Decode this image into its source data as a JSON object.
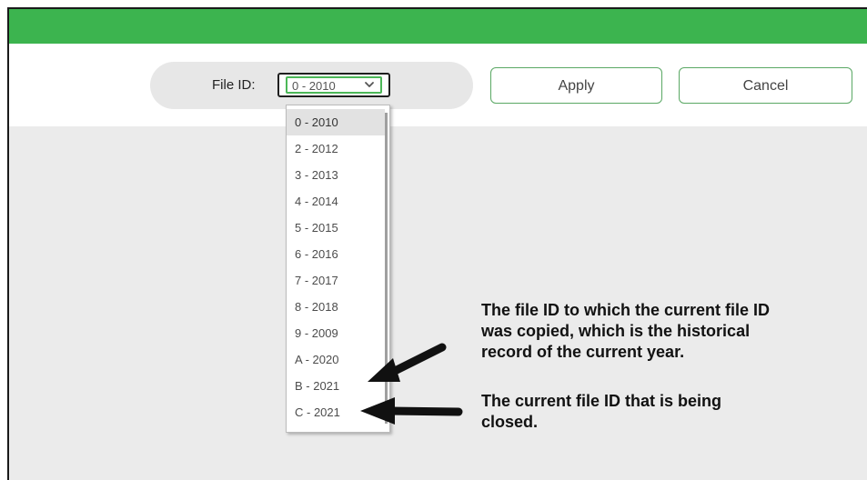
{
  "file_id": {
    "label": "File ID:",
    "selected": "0 - 2010",
    "options": [
      "0 - 2010",
      "2 - 2012",
      "3 - 2013",
      "4 - 2014",
      "5 - 2015",
      "6 - 2016",
      "7 - 2017",
      "8 - 2018",
      "9 - 2009",
      "A - 2020",
      "B - 2021",
      "C - 2021"
    ]
  },
  "buttons": {
    "apply": "Apply",
    "cancel": "Cancel"
  },
  "annotations": {
    "historical": [
      "The file ID to which the current file ID",
      "was copied, which is the historical",
      "record of the current year."
    ],
    "current": [
      "The current file ID that is being",
      "closed."
    ]
  },
  "colors": {
    "header_green": "#3cb44f",
    "button_border": "#5aa864",
    "select_focus": "#4cb858",
    "content_gray": "#ebebeb"
  },
  "icons": {
    "select_chevron": "chevron-down-icon",
    "historical_arrow": "arrow-left-icon",
    "current_arrow": "arrow-left-icon"
  }
}
